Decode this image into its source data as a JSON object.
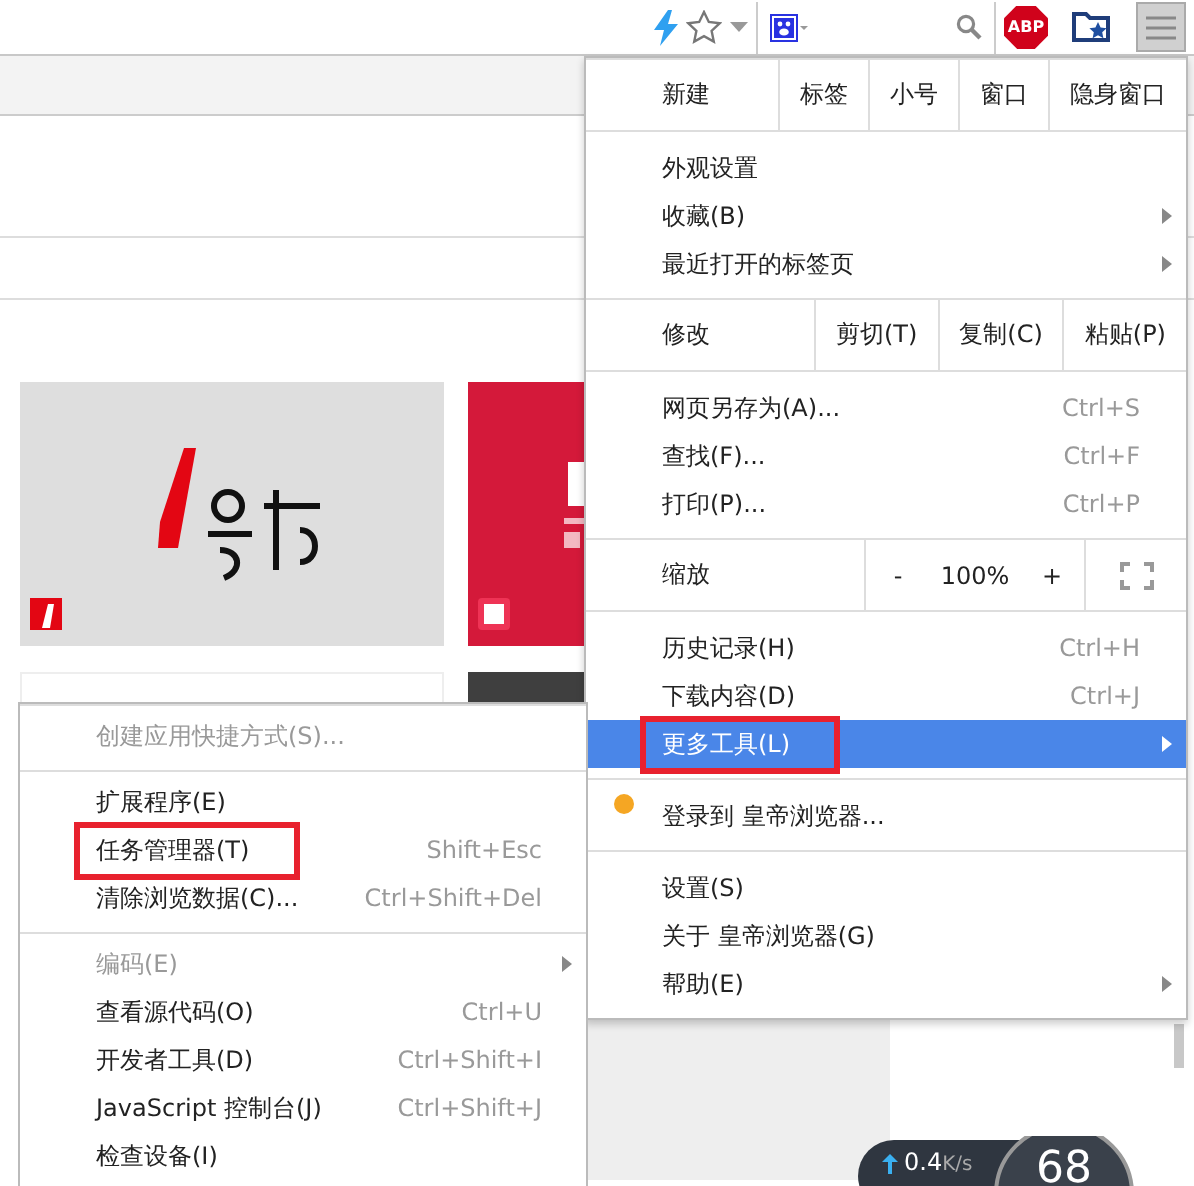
{
  "toolbar": {
    "adblock_label": "ABP",
    "menu_button": {
      "selected": true
    }
  },
  "menu": {
    "sections": [
      {
        "kind": "buttons",
        "label": "新建",
        "buttons": [
          "标签",
          "小号",
          "窗口",
          "隐身窗口"
        ]
      },
      {
        "kind": "items",
        "items": [
          {
            "label": "外观设置",
            "submenu": false,
            "selected": false,
            "marked": false
          },
          {
            "label": "收藏(B)",
            "submenu": true,
            "selected": false,
            "marked": false
          },
          {
            "label": "最近打开的标签页",
            "submenu": true,
            "selected": false,
            "marked": false
          }
        ]
      },
      {
        "kind": "buttons",
        "label": "修改",
        "buttons": [
          "剪切(T)",
          "复制(C)",
          "粘贴(P)"
        ]
      },
      {
        "kind": "items",
        "items": [
          {
            "label": "网页另存为(A)...",
            "shortcut": "Ctrl+S",
            "submenu": false,
            "selected": false,
            "marked": false
          },
          {
            "label": "查找(F)...",
            "shortcut": "Ctrl+F",
            "submenu": false,
            "selected": false,
            "marked": false
          },
          {
            "label": "打印(P)...",
            "shortcut": "Ctrl+P",
            "submenu": false,
            "selected": false,
            "marked": false
          }
        ]
      },
      {
        "kind": "zoom",
        "label": "缩放",
        "minus": "-",
        "value": "100%",
        "plus": "+"
      },
      {
        "kind": "items",
        "items": [
          {
            "label": "历史记录(H)",
            "shortcut": "Ctrl+H",
            "submenu": false,
            "selected": false,
            "marked": false
          },
          {
            "label": "下载内容(D)",
            "shortcut": "Ctrl+J",
            "submenu": false,
            "selected": false,
            "marked": false
          },
          {
            "label": "更多工具(L)",
            "submenu": true,
            "selected": true,
            "marked": true
          }
        ]
      },
      {
        "kind": "account",
        "label": "登录到 皇帝浏览器...",
        "color": "#f5a623"
      },
      {
        "kind": "items",
        "items": [
          {
            "label": "设置(S)",
            "submenu": false,
            "selected": false,
            "marked": false
          },
          {
            "label": "关于 皇帝浏览器(G)",
            "submenu": false,
            "selected": false,
            "marked": false
          },
          {
            "label": "帮助(E)",
            "submenu": true,
            "selected": false,
            "marked": false
          }
        ]
      }
    ]
  },
  "submenu": {
    "sections": [
      [
        {
          "label": "创建应用快捷方式(S)...",
          "disabled": true,
          "submenu": false,
          "marked": false
        }
      ],
      [
        {
          "label": "扩展程序(E)",
          "disabled": false,
          "submenu": false,
          "marked": false
        },
        {
          "label": "任务管理器(T)",
          "shortcut": "Shift+Esc",
          "disabled": false,
          "submenu": false,
          "marked": true
        },
        {
          "label": "清除浏览数据(C)...",
          "shortcut": "Ctrl+Shift+Del",
          "disabled": false,
          "submenu": false,
          "marked": false
        }
      ],
      [
        {
          "label": "编码(E)",
          "disabled": true,
          "submenu": true,
          "marked": false
        },
        {
          "label": "查看源代码(O)",
          "shortcut": "Ctrl+U",
          "disabled": false,
          "submenu": false,
          "marked": false
        },
        {
          "label": "开发者工具(D)",
          "shortcut": "Ctrl+Shift+I",
          "disabled": false,
          "submenu": false,
          "marked": false
        },
        {
          "label": "JavaScript 控制台(J)",
          "shortcut": "Ctrl+Shift+J",
          "disabled": false,
          "submenu": false,
          "marked": false
        },
        {
          "label": "检查设备(I)",
          "disabled": false,
          "submenu": false,
          "marked": false
        }
      ]
    ]
  },
  "speed_widget": {
    "upload": "0.4",
    "unit": "K/s",
    "score": "68"
  }
}
